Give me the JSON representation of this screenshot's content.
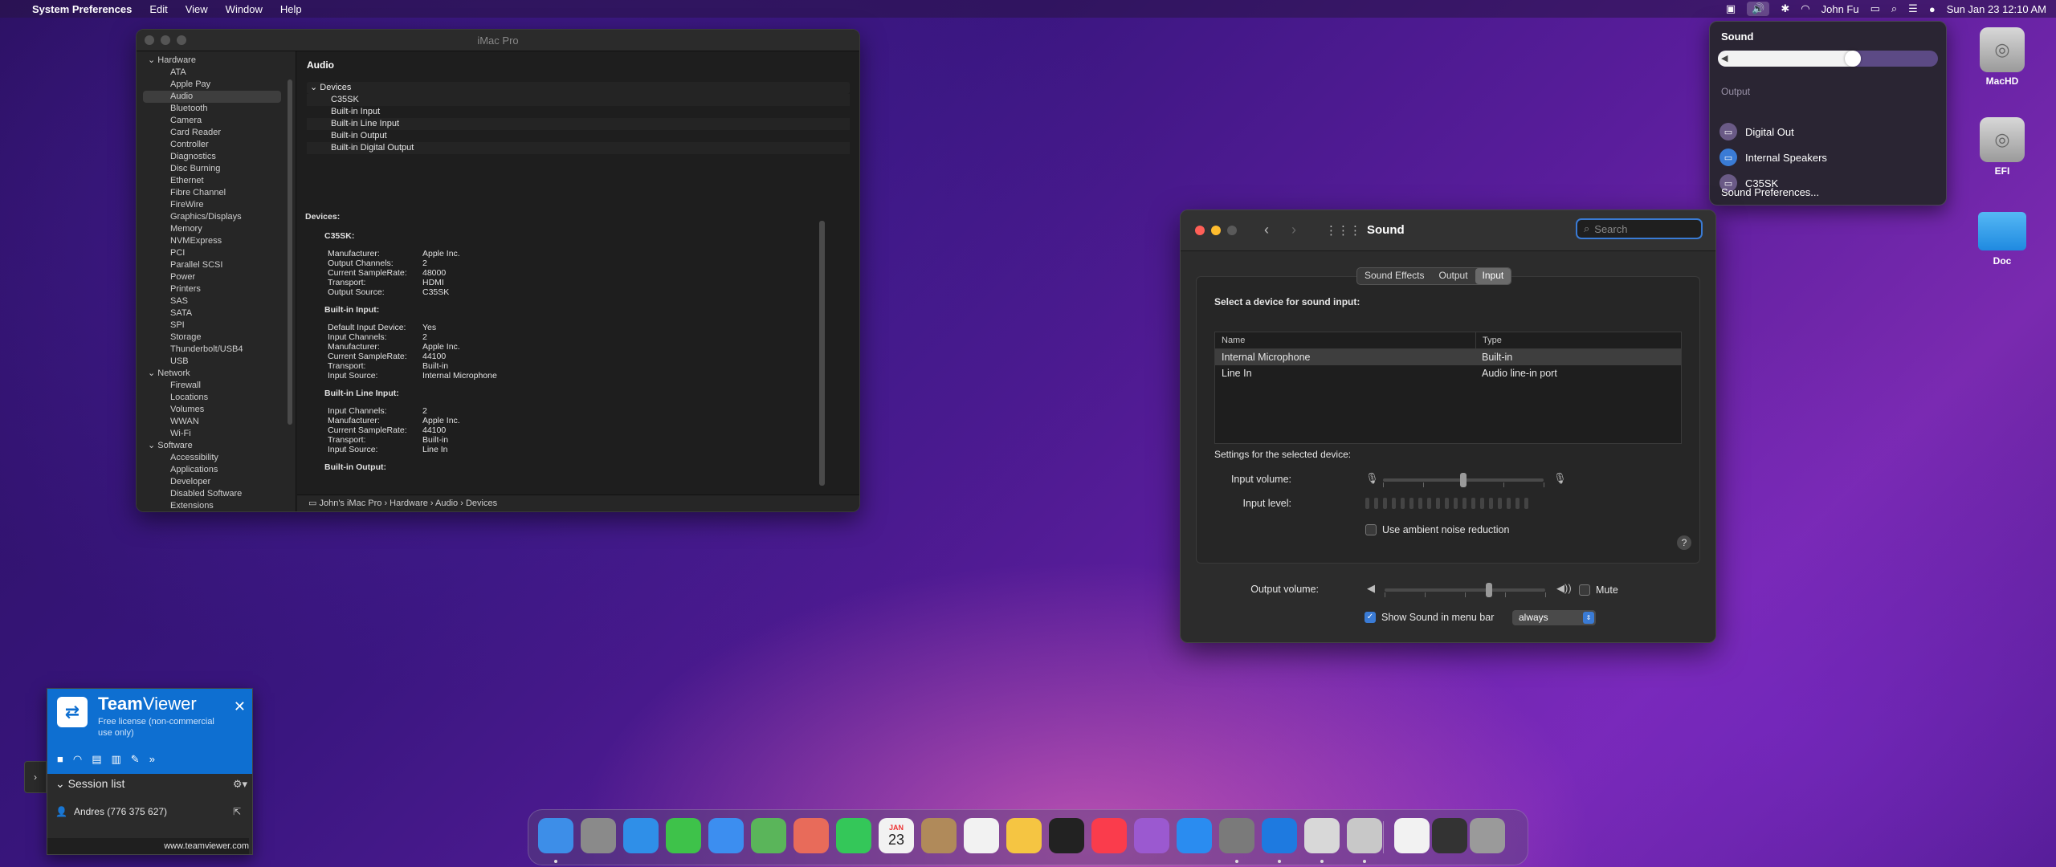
{
  "menubar": {
    "apple": "",
    "app_name": "System Preferences",
    "menus": [
      "Edit",
      "View",
      "Window",
      "Help"
    ],
    "user": "John Fu",
    "datetime": "Sun Jan 23  12:10 AM"
  },
  "sound_menu": {
    "title": "Sound",
    "volume_percent": 65,
    "output_label": "Output",
    "outputs": [
      {
        "label": "Digital Out",
        "selected": false
      },
      {
        "label": "Internal Speakers",
        "selected": true
      },
      {
        "label": "C35SK",
        "selected": false
      }
    ],
    "prefs_link": "Sound Preferences..."
  },
  "desktop": {
    "icons": [
      {
        "label": "MacHD"
      },
      {
        "label": "EFI"
      },
      {
        "label": "Doc"
      }
    ]
  },
  "sysinfo": {
    "title": "iMac Pro",
    "sidebar": {
      "hardware_label": "Hardware",
      "hardware_items": [
        "ATA",
        "Apple Pay",
        "Audio",
        "Bluetooth",
        "Camera",
        "Card Reader",
        "Controller",
        "Diagnostics",
        "Disc Burning",
        "Ethernet",
        "Fibre Channel",
        "FireWire",
        "Graphics/Displays",
        "Memory",
        "NVMExpress",
        "PCI",
        "Parallel SCSI",
        "Power",
        "Printers",
        "SAS",
        "SATA",
        "SPI",
        "Storage",
        "Thunderbolt/USB4",
        "USB"
      ],
      "selected": "Audio",
      "network_label": "Network",
      "network_items": [
        "Firewall",
        "Locations",
        "Volumes",
        "WWAN",
        "Wi-Fi"
      ],
      "software_label": "Software",
      "software_items": [
        "Accessibility",
        "Applications",
        "Developer",
        "Disabled Software",
        "Extensions"
      ]
    },
    "header": "Audio",
    "tree_head": "Devices",
    "tree_items": [
      "C35SK",
      "Built-in Input",
      "Built-in Line Input",
      "Built-in Output",
      "Built-in Digital Output"
    ],
    "detail_title": "Devices:",
    "devices": [
      {
        "name": "C35SK:",
        "props": [
          [
            "Manufacturer:",
            "Apple Inc."
          ],
          [
            "Output Channels:",
            "2"
          ],
          [
            "Current SampleRate:",
            "48000"
          ],
          [
            "Transport:",
            "HDMI"
          ],
          [
            "Output Source:",
            "C35SK"
          ]
        ]
      },
      {
        "name": "Built-in Input:",
        "props": [
          [
            "Default Input Device:",
            "Yes"
          ],
          [
            "Input Channels:",
            "2"
          ],
          [
            "Manufacturer:",
            "Apple Inc."
          ],
          [
            "Current SampleRate:",
            "44100"
          ],
          [
            "Transport:",
            "Built-in"
          ],
          [
            "Input Source:",
            "Internal Microphone"
          ]
        ]
      },
      {
        "name": "Built-in Line Input:",
        "props": [
          [
            "Input Channels:",
            "2"
          ],
          [
            "Manufacturer:",
            "Apple Inc."
          ],
          [
            "Current SampleRate:",
            "44100"
          ],
          [
            "Transport:",
            "Built-in"
          ],
          [
            "Input Source:",
            "Line In"
          ]
        ]
      },
      {
        "name": "Built-in Output:",
        "props": []
      }
    ],
    "path": [
      "John's iMac Pro",
      "Hardware",
      "Audio",
      "Devices"
    ]
  },
  "sound_prefs": {
    "title": "Sound",
    "search_placeholder": "Search",
    "tabs": [
      "Sound Effects",
      "Output",
      "Input"
    ],
    "selected_tab": "Input",
    "select_device_label": "Select a device for sound input:",
    "columns": [
      "Name",
      "Type"
    ],
    "rows": [
      {
        "name": "Internal Microphone",
        "type": "Built-in",
        "selected": true
      },
      {
        "name": "Line In",
        "type": "Audio line-in port",
        "selected": false
      }
    ],
    "settings_label": "Settings for the selected device:",
    "input_volume_label": "Input volume:",
    "input_volume_fraction": 0.5,
    "input_level_label": "Input level:",
    "ambient_label": "Use ambient noise reduction",
    "ambient_checked": false,
    "help": "?",
    "output_volume_label": "Output volume:",
    "output_volume_fraction": 0.65,
    "mute_label": "Mute",
    "mute_checked": false,
    "show_in_menubar_label": "Show Sound in menu bar",
    "show_in_menubar_checked": true,
    "show_in_menubar_value": "always"
  },
  "teamviewer": {
    "brand_bold": "Team",
    "brand_rest": "Viewer",
    "license": "Free license (non-commercial use only)",
    "session_list": "Session list",
    "contact": "Andres (776 375 627)",
    "url": "www.teamviewer.com"
  },
  "dock": {
    "apps": [
      "Finder",
      "Launchpad",
      "Safari",
      "Messages",
      "Mail",
      "Maps",
      "Photos",
      "FaceTime",
      "Calendar",
      "Contacts",
      "Reminders",
      "Notes",
      "TV",
      "Music",
      "Podcasts",
      "App Store",
      "System Preferences",
      "TeamViewer",
      "Preview",
      "Disk Utility"
    ],
    "calendar_month": "JAN",
    "calendar_day": "23"
  }
}
